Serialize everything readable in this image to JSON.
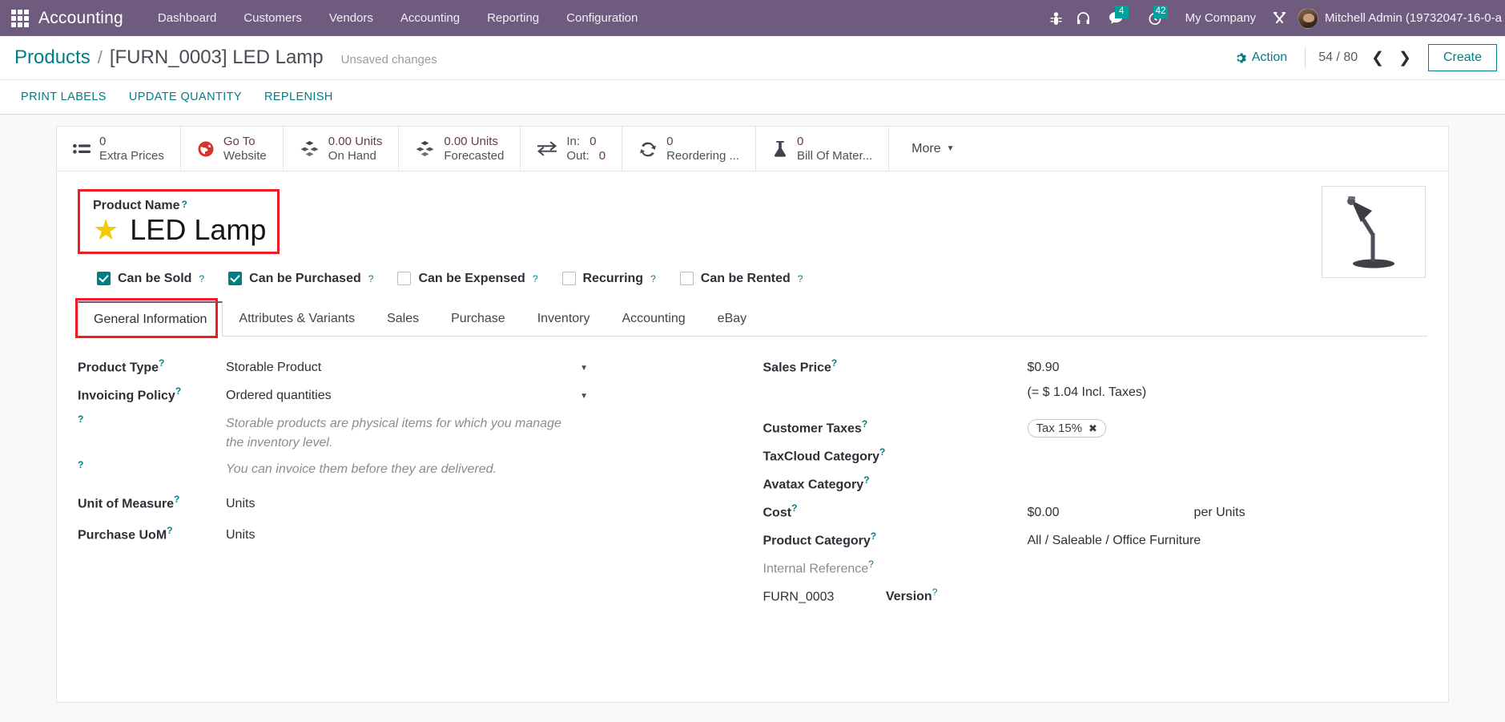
{
  "navbar": {
    "apps_icon": "apps-grid-icon",
    "brand": "Accounting",
    "menu": [
      {
        "label": "Dashboard"
      },
      {
        "label": "Customers"
      },
      {
        "label": "Vendors"
      },
      {
        "label": "Accounting"
      },
      {
        "label": "Reporting"
      },
      {
        "label": "Configuration"
      }
    ],
    "sys_icons": [
      {
        "name": "bug-icon",
        "badge": null
      },
      {
        "name": "headphones-icon",
        "badge": null
      },
      {
        "name": "messages-icon",
        "badge": "4"
      },
      {
        "name": "activities-clock-icon",
        "badge": "42"
      }
    ],
    "company": "My Company",
    "tools_icon": "tools-icon",
    "username": "Mitchell Admin (19732047-16-0-a",
    "badge_color": "#00a09d",
    "bar_color": "#6f5b7e"
  },
  "breadcrumb": {
    "root": "Products",
    "separator": "/",
    "current": "[FURN_0003] LED Lamp",
    "dirty_status": "Unsaved changes"
  },
  "control_panel": {
    "action_label": "Action",
    "gear_icon": "gear-icon",
    "pager": "54 / 80",
    "prev_icon": "chevron-left-icon",
    "next_icon": "chevron-right-icon",
    "create_label": "Create",
    "buttons": [
      {
        "label": "PRINT LABELS"
      },
      {
        "label": "UPDATE QUANTITY"
      },
      {
        "label": "REPLENISH"
      }
    ]
  },
  "stat_buttons": [
    {
      "icon": "list-icon",
      "value": "0",
      "label": "Extra Prices"
    },
    {
      "icon": "globe-icon",
      "value": "Go To",
      "label": "Website"
    },
    {
      "icon": "cubes-icon",
      "value": "0.00 Units",
      "label": "On Hand"
    },
    {
      "icon": "cubes-icon",
      "value": "0.00 Units",
      "label": "Forecasted"
    },
    {
      "icon": "exchange-icon",
      "in_label": "In:",
      "in_value": "0",
      "out_label": "Out:",
      "out_value": "0",
      "label": ""
    },
    {
      "icon": "refresh-icon",
      "value": "0",
      "label": "Reordering ..."
    },
    {
      "icon": "flask-icon",
      "value": "0",
      "label": "Bill Of Mater..."
    }
  ],
  "stat_more": {
    "label": "More",
    "icon": "caret-down-icon"
  },
  "product": {
    "name_label": "Product Name",
    "name": "LED Lamp",
    "favorite_icon": "star-icon",
    "favorite": true,
    "highlight_color": "#ee1c25",
    "image_alt": "desk-lamp-image"
  },
  "checkboxes": [
    {
      "label": "Can be Sold",
      "checked": true
    },
    {
      "label": "Can be Purchased",
      "checked": true
    },
    {
      "label": "Can be Expensed",
      "checked": false
    },
    {
      "label": "Recurring",
      "checked": false
    },
    {
      "label": "Can be Rented",
      "checked": false
    }
  ],
  "tabs": [
    {
      "label": "General Information",
      "active": true
    },
    {
      "label": "Attributes & Variants",
      "active": false
    },
    {
      "label": "Sales",
      "active": false
    },
    {
      "label": "Purchase",
      "active": false
    },
    {
      "label": "Inventory",
      "active": false
    },
    {
      "label": "Accounting",
      "active": false
    },
    {
      "label": "eBay",
      "active": false
    }
  ],
  "form_left": {
    "product_type": {
      "label": "Product Type",
      "value": "Storable Product"
    },
    "invoicing_policy": {
      "label": "Invoicing Policy",
      "value": "Ordered quantities"
    },
    "hint_1": "Storable products are physical items for which you manage the inventory level.",
    "hint_2": "You can invoice them before they are delivered.",
    "unit_of_measure": {
      "label": "Unit of Measure",
      "value": "Units"
    },
    "purchase_uom": {
      "label": "Purchase UoM",
      "value": "Units"
    }
  },
  "form_right": {
    "sales_price": {
      "label": "Sales Price",
      "value": "$0.90"
    },
    "incl_taxes_note": "(= $ 1.04 Incl. Taxes)",
    "customer_taxes": {
      "label": "Customer Taxes",
      "tag": "Tax 15%",
      "remove_icon": "remove-tag-icon"
    },
    "taxcloud_category": {
      "label": "TaxCloud Category",
      "value": ""
    },
    "avatax_category": {
      "label": "Avatax Category",
      "value": ""
    },
    "cost": {
      "label": "Cost",
      "value": "$0.00",
      "suffix": "per Units"
    },
    "product_category": {
      "label": "Product Category",
      "value": "All / Saleable / Office Furniture"
    },
    "internal_reference": {
      "label": "Internal Reference",
      "value": "FURN_0003"
    },
    "version": {
      "label": "Version"
    }
  }
}
